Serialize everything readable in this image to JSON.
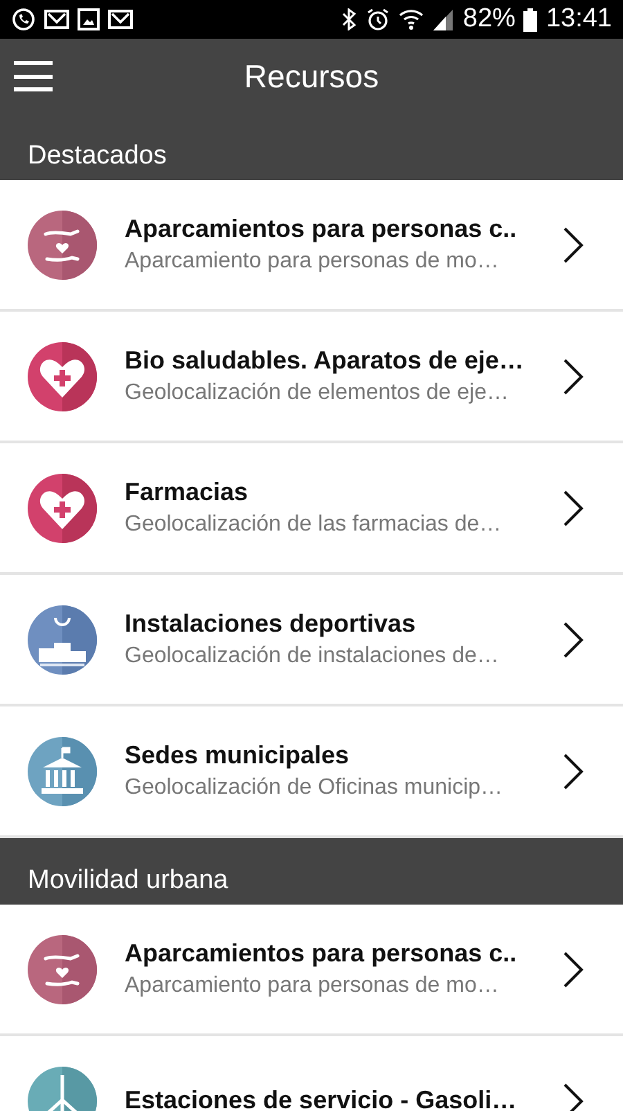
{
  "status_bar": {
    "battery": "82%",
    "time": "13:41"
  },
  "app_bar": {
    "title": "Recursos"
  },
  "sections": [
    {
      "title": "Destacados",
      "items": [
        {
          "kind": "hands",
          "title": "Aparcamientos para personas c..",
          "subtitle": "Aparcamiento para personas de mo…"
        },
        {
          "kind": "heart",
          "title": "Bio saludables. Aparatos de eje…",
          "subtitle": "Geolocalización de elementos de eje…"
        },
        {
          "kind": "heart",
          "title": "Farmacias",
          "subtitle": "Geolocalización de las farmacias de…"
        },
        {
          "kind": "podium",
          "title": "Instalaciones deportivas",
          "subtitle": "Geolocalización de instalaciones de…"
        },
        {
          "kind": "building",
          "title": "Sedes municipales",
          "subtitle": "Geolocalización de Oficinas municip…"
        }
      ]
    },
    {
      "title": "Movilidad urbana",
      "items": [
        {
          "kind": "hands",
          "title": "Aparcamientos para personas c..",
          "subtitle": "Aparcamiento para personas de mo…"
        },
        {
          "kind": "windmill",
          "title": "Estaciones de servicio - Gasoli…"
        }
      ]
    }
  ]
}
